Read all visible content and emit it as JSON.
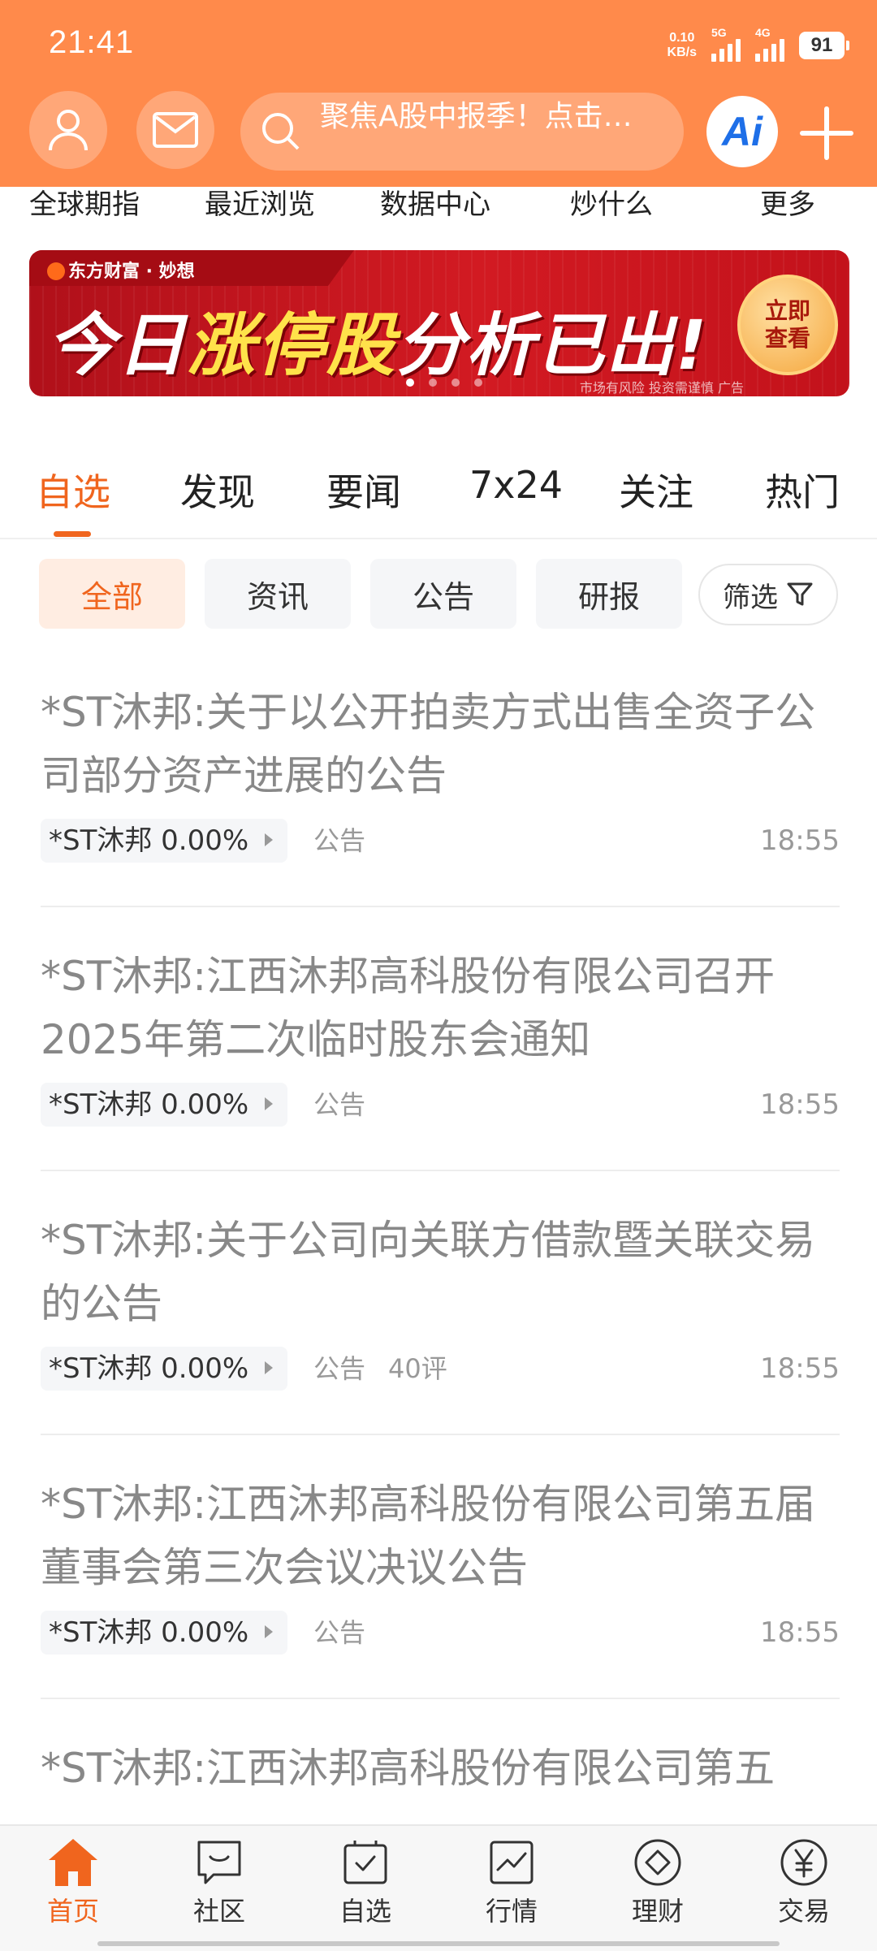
{
  "status_bar": {
    "time": "21:41",
    "net_speed_value": "0.10",
    "net_speed_unit": "KB/s",
    "signal1_label": "5G",
    "signal2_label": "4G",
    "battery": "91"
  },
  "header": {
    "search_text": "聚焦A股中报季！点击…",
    "ai_label": "Ai"
  },
  "quick_menu": [
    "全球期指",
    "最近浏览",
    "数据中心",
    "炒什么",
    "更多"
  ],
  "banner": {
    "brand": "东方财富 · 妙想",
    "headline_part1": "今日",
    "headline_highlight": "涨停股",
    "headline_part2": "分析已出!",
    "cta": "立即查看",
    "disclaimer": "市场有风险 投资需谨慎  广告",
    "pages": 4,
    "active_page": 1
  },
  "content_tabs": [
    "自选",
    "发现",
    "要闻",
    "7x24",
    "关注",
    "热门"
  ],
  "active_tab": "自选",
  "filter_chips": [
    "全部",
    "资讯",
    "公告",
    "研报"
  ],
  "filter_button": "筛选",
  "news": [
    {
      "title": "*ST沐邦:关于以公开拍卖方式出售全资子公司部分资产进展的公告",
      "stock": "*ST沐邦 0.00%",
      "type": "公告",
      "comments": "",
      "time": "18:55"
    },
    {
      "title": "*ST沐邦:江西沐邦高科股份有限公司召开2025年第二次临时股东会通知",
      "stock": "*ST沐邦 0.00%",
      "type": "公告",
      "comments": "",
      "time": "18:55"
    },
    {
      "title": "*ST沐邦:关于公司向关联方借款暨关联交易的公告",
      "stock": "*ST沐邦 0.00%",
      "type": "公告",
      "comments": "40评",
      "time": "18:55"
    },
    {
      "title": "*ST沐邦:江西沐邦高科股份有限公司第五届董事会第三次会议决议公告",
      "stock": "*ST沐邦 0.00%",
      "type": "公告",
      "comments": "",
      "time": "18:55"
    },
    {
      "title": "*ST沐邦:江西沐邦高科股份有限公司第五",
      "stock": "",
      "type": "",
      "comments": "",
      "time": ""
    }
  ],
  "bottom_nav": [
    {
      "label": "首页",
      "icon": "home-icon",
      "active": true
    },
    {
      "label": "社区",
      "icon": "community-icon",
      "active": false
    },
    {
      "label": "自选",
      "icon": "watchlist-icon",
      "active": false
    },
    {
      "label": "行情",
      "icon": "market-icon",
      "active": false
    },
    {
      "label": "理财",
      "icon": "wealth-icon",
      "active": false
    },
    {
      "label": "交易",
      "icon": "trade-icon",
      "active": false
    }
  ],
  "colors": {
    "header_orange": "#FF8A4B",
    "accent": "#F0651E",
    "banner_red": "#D21A22"
  }
}
